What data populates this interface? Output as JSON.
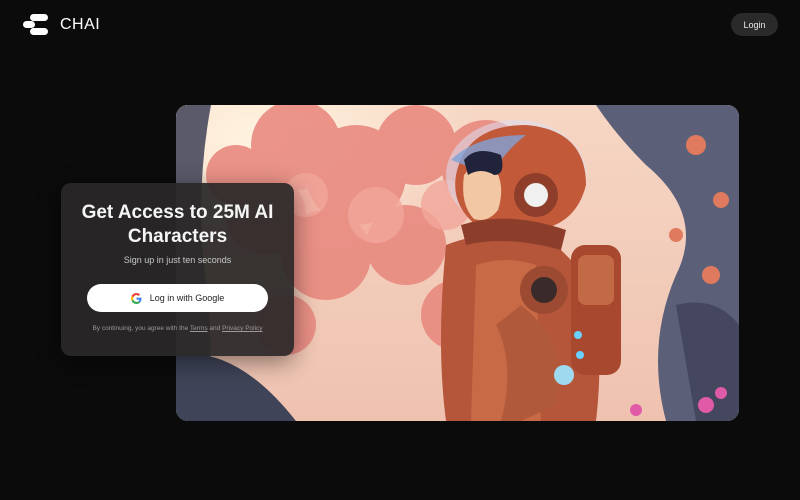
{
  "header": {
    "brand": "CHAI",
    "login_label": "Login"
  },
  "card": {
    "title": "Get Access to 25M AI Characters",
    "subtitle": "Sign up in just ten seconds",
    "google_button_label": "Log in with Google",
    "legal_prefix": "By continuing, you agree with the",
    "terms_label": "Terms",
    "legal_and": "and",
    "privacy_label": "Privacy Policy"
  },
  "hero_image": {
    "icon": "astronaut-forest-illustration"
  },
  "colors": {
    "background": "#0b0b0b",
    "card": "#2a2828",
    "button": "#ffffff"
  }
}
